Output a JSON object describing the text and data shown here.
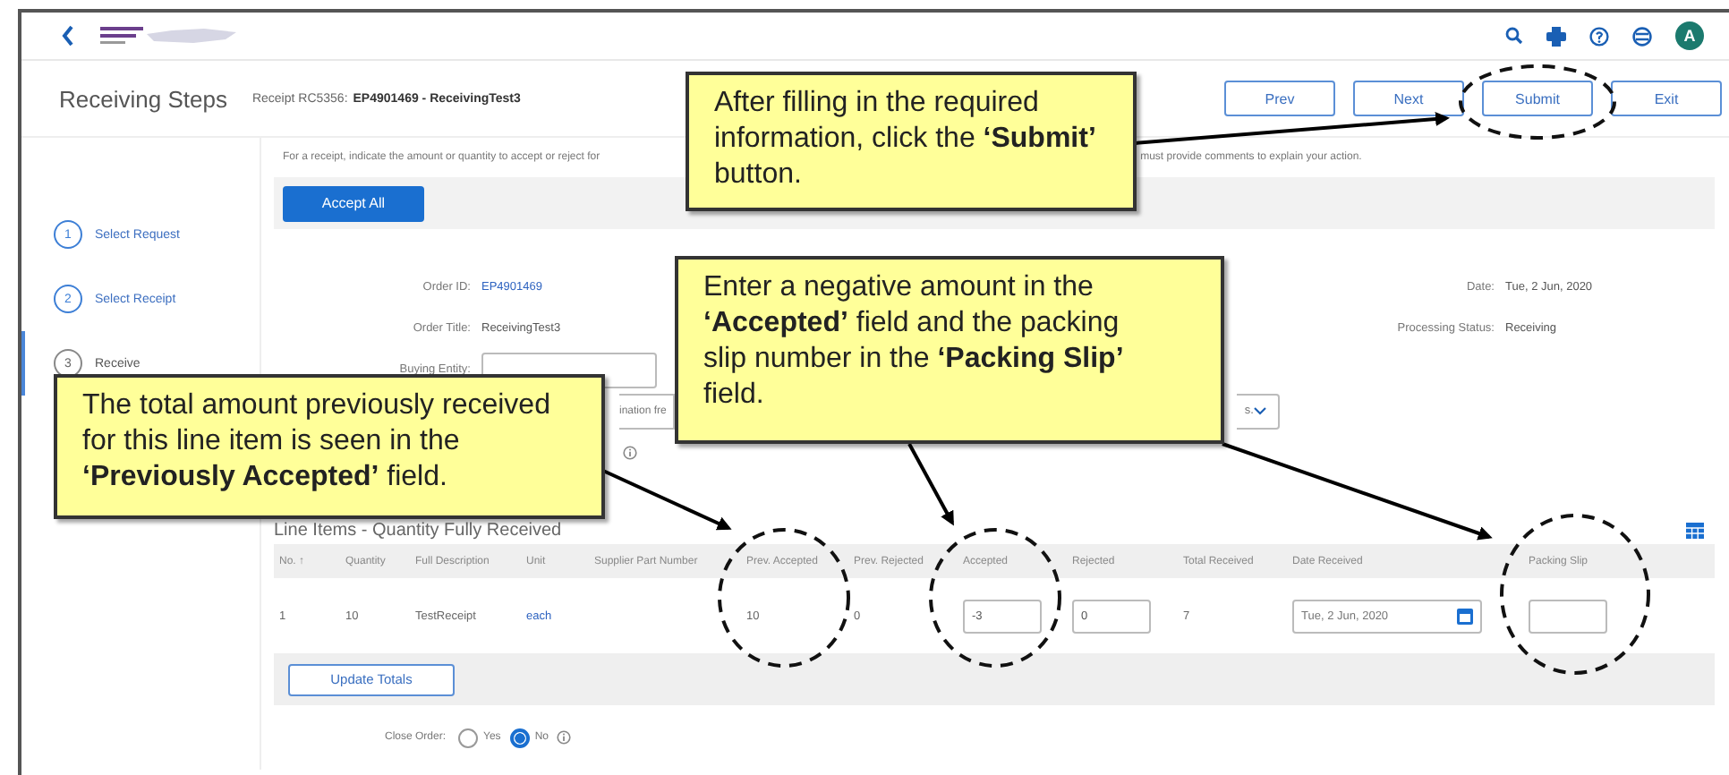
{
  "header": {
    "avatar": "A"
  },
  "page": {
    "title": "Receiving Steps",
    "receipt_label": "Receipt RC5356:",
    "receipt_name": "EP4901469 - ReceivingTest3"
  },
  "buttons": [
    "Prev",
    "Next",
    "Submit",
    "Exit"
  ],
  "steps": [
    {
      "number": "1",
      "label": "Select Request",
      "selected": false
    },
    {
      "number": "2",
      "label": "Select Receipt",
      "selected": false
    },
    {
      "number": "3",
      "label": "Receive",
      "selected": true
    }
  ],
  "instructions": [
    "For a receipt, indicate the amount or quantity to accept or reject for",
    "must provide comments to explain your action."
  ],
  "accept_all": "Accept All",
  "fields_left": [
    {
      "label": "Order ID:",
      "value": "EP4901469",
      "kind": "link"
    },
    {
      "label": "Order Title:",
      "value": "ReceivingTest3",
      "kind": "text"
    },
    {
      "label": "Buying Entity:",
      "kind": "input"
    }
  ],
  "partial_field": "ination fre",
  "partial_dropdown": "s.",
  "fields_right": [
    {
      "label": "Date:",
      "value": "Tue, 2 Jun, 2020"
    },
    {
      "label": "Processing Status:",
      "value": "Receiving"
    }
  ],
  "table": {
    "title": "Line Items - Quantity Fully Received",
    "columns": [
      "No. ↑",
      "Quantity",
      "Full Description",
      "Unit",
      "Supplier Part Number",
      "Prev. Accepted",
      "Prev. Rejected",
      "Accepted",
      "Rejected",
      "Total Received",
      "Date Received",
      "Packing Slip"
    ],
    "rows": [
      [
        {
          "kind": "text",
          "value": "1"
        },
        {
          "kind": "text",
          "value": "10"
        },
        {
          "kind": "text",
          "value": "TestReceipt"
        },
        {
          "kind": "link",
          "value": "each"
        },
        {
          "kind": "empty"
        },
        {
          "kind": "text",
          "value": "10"
        },
        {
          "kind": "text",
          "value": "0"
        },
        {
          "kind": "input",
          "value": "-3"
        },
        {
          "kind": "input",
          "value": "0"
        },
        {
          "kind": "text",
          "value": "7"
        },
        {
          "kind": "date",
          "value": "Tue, 2 Jun, 2020"
        },
        {
          "kind": "input"
        }
      ]
    ]
  },
  "update_totals": "Update Totals",
  "close_order": {
    "label": "Close Order:",
    "options": [
      {
        "label": "Yes",
        "selected": false
      },
      {
        "label": "No",
        "selected": true
      }
    ]
  },
  "callouts": [
    "After filling in the required information, click the **‘Submit’** button.",
    "Enter a negative amount in the **‘Accepted’** field and the packing slip number in the **‘Packing Slip’** field.",
    "The total amount previously received for this line item is seen in the **‘Previously Accepted’** field."
  ]
}
